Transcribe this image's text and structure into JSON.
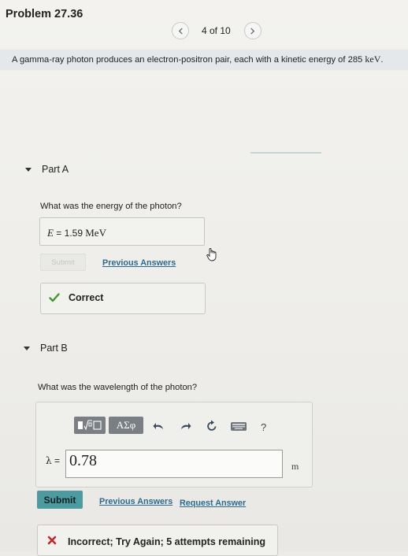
{
  "header": {
    "title": "Problem 27.36"
  },
  "pager": {
    "text": "4 of 10",
    "prev_icon": "chevron-left-icon",
    "next_icon": "chevron-right-icon"
  },
  "problem": {
    "statement": "A gamma-ray photon produces an electron-positron pair, each with a kinetic energy of 285 ",
    "unit": "keV",
    "end": "."
  },
  "partA": {
    "label": "Part A",
    "question": "What was the energy of the photon?",
    "answer_var": "E",
    "answer_eq": " = ",
    "answer_value": "1.59",
    "answer_unit": " MeV",
    "submit_label": "Submit",
    "previous_answers_label": "Previous Answers",
    "feedback": "Correct"
  },
  "partB": {
    "label": "Part B",
    "question": "What was the wavelength of the photon?",
    "toolbar": {
      "template_label": "▮√▯",
      "symbols_label": "ΑΣφ",
      "help_label": "?"
    },
    "lambda_symbol": "λ",
    "lambda_eq": " = ",
    "input_value": "0.78",
    "unit": "m",
    "submit_label": "Submit",
    "previous_answers_label": "Previous Answers",
    "request_answer_label": "Request Answer",
    "feedback": "Incorrect; Try Again; 5 attempts remaining"
  },
  "colors": {
    "link": "#2e6a8e",
    "submit": "#4d9aa0",
    "correct": "#3f9a2e",
    "incorrect": "#c0272d"
  }
}
